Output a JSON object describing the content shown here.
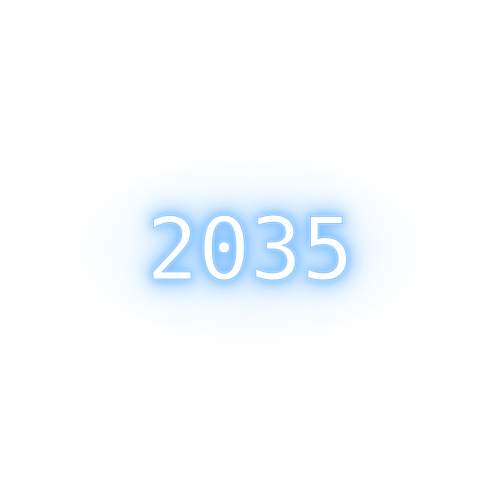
{
  "display": {
    "year_text": "2035"
  },
  "colors": {
    "background": "#ffffff",
    "glow": "#5aaeff",
    "text_fill": "#ffffff"
  }
}
